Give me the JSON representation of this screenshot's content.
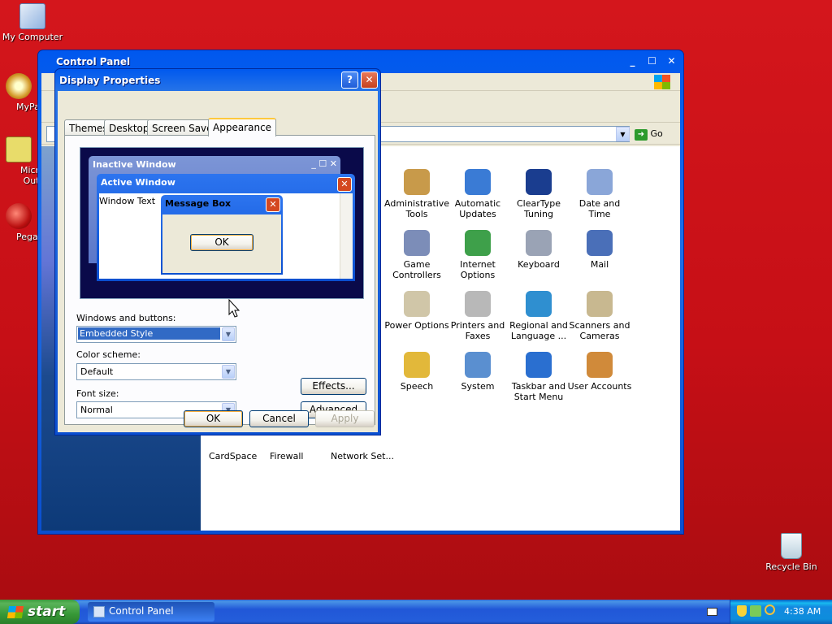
{
  "desktop": {
    "icons": [
      {
        "label": "My Computer",
        "icon": "my-computer-icon"
      },
      {
        "label": "MyPal",
        "icon": "mypal-icon"
      },
      {
        "label": "Microsoft Outlook",
        "icon": "outlook-icon"
      },
      {
        "label": "Pegasus",
        "icon": "pegasus-icon"
      },
      {
        "label": "Recycle Bin",
        "icon": "recycle-bin-icon"
      }
    ]
  },
  "control_panel": {
    "title": "Control Panel",
    "address_go": "Go",
    "items": [
      {
        "label": "Administrative Tools",
        "color": "#c89a4a"
      },
      {
        "label": "Automatic Updates",
        "color": "#3a7bd5"
      },
      {
        "label": "ClearType Tuning",
        "color": "#1a3d8f"
      },
      {
        "label": "Date and Time",
        "color": "#8aa6d8"
      },
      {
        "label": "Game Controllers",
        "color": "#7c8db8"
      },
      {
        "label": "Internet Options",
        "color": "#3ea04a"
      },
      {
        "label": "Keyboard",
        "color": "#9aa3b5"
      },
      {
        "label": "Mail",
        "color": "#4a6fb8"
      },
      {
        "label": "Power Options",
        "color": "#d0c6a8"
      },
      {
        "label": "Printers and Faxes",
        "color": "#b8b8b8"
      },
      {
        "label": "Regional and Language ...",
        "color": "#2f8fd0"
      },
      {
        "label": "Scanners and Cameras",
        "color": "#c8b890"
      },
      {
        "label": "Speech",
        "color": "#e2b83a"
      },
      {
        "label": "System",
        "color": "#5a8fd0"
      },
      {
        "label": "Taskbar and Start Menu",
        "color": "#2a6fd0"
      },
      {
        "label": "User Accounts",
        "color": "#d08a3a"
      }
    ],
    "partial_items": [
      "CardSpace",
      "Firewall",
      "Network Set..."
    ]
  },
  "display_properties": {
    "title": "Display Properties",
    "help": "?",
    "tabs": [
      "Themes",
      "Desktop",
      "Screen Saver",
      "Appearance"
    ],
    "active_tab": "Appearance",
    "preview": {
      "inactive_window": "Inactive Window",
      "active_window": "Active Window",
      "window_text": "Window Text",
      "message_box": "Message Box",
      "message_ok": "OK"
    },
    "windows_buttons_label": "Windows and buttons:",
    "windows_buttons_value": "Embedded Style",
    "color_scheme_label": "Color scheme:",
    "color_scheme_value": "Default",
    "font_size_label": "Font size:",
    "font_size_value": "Normal",
    "effects_btn": "Effects...",
    "advanced_btn": "Advanced",
    "ok_btn": "OK",
    "cancel_btn": "Cancel",
    "apply_btn": "Apply"
  },
  "taskbar": {
    "start_label": "start",
    "task_button": "Control Panel",
    "clock": "4:38 AM"
  }
}
